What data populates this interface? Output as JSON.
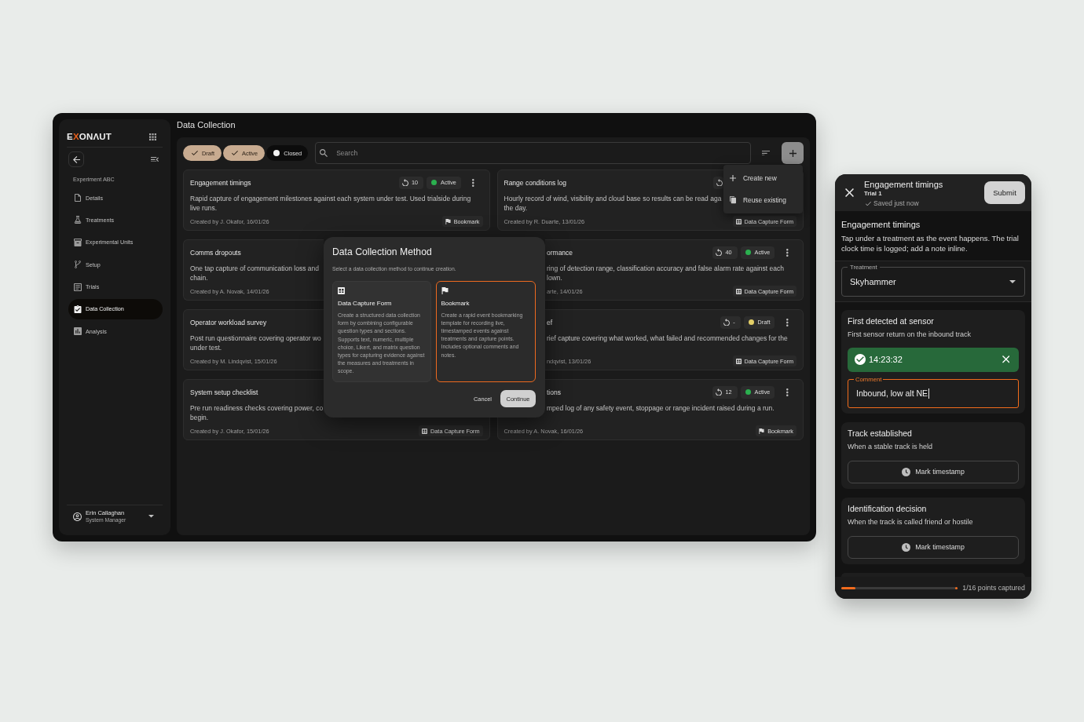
{
  "page": {
    "title": "Data Collection"
  },
  "sidebar": {
    "logo": [
      {
        "text": "E",
        "accent": false
      },
      {
        "text": "X",
        "accent": true
      },
      {
        "text": "ONΛUT",
        "accent": false
      }
    ],
    "section": "Experiment ABC",
    "items": [
      {
        "label": "Details",
        "selected": false
      },
      {
        "label": "Treatments",
        "selected": false
      },
      {
        "label": "Experimental Units",
        "selected": false
      },
      {
        "label": "Setup",
        "selected": false
      },
      {
        "label": "Trials",
        "selected": false
      },
      {
        "label": "Data Collection",
        "selected": true
      },
      {
        "label": "Analysis",
        "selected": false
      }
    ],
    "user": {
      "name": "Erin Callaghan",
      "role": "System Manager"
    }
  },
  "toolbar": {
    "filters": [
      {
        "label": "Draft",
        "selected": true
      },
      {
        "label": "Active",
        "selected": true
      },
      {
        "label": "Closed",
        "selected": false
      }
    ],
    "search": {
      "placeholder": "Search"
    },
    "create_menu": {
      "open": true,
      "items": [
        "Create new",
        "Reuse existing"
      ]
    }
  },
  "cards": [
    {
      "title": "Engagement timings",
      "badges": [
        {
          "kind": "counter",
          "value": "10"
        },
        {
          "kind": "status",
          "label": "Active",
          "color": "#2bb04f"
        }
      ],
      "menu": true,
      "description": [
        "Rapid capture of engagement milestones against each system under test. Used trialside during",
        "live runs."
      ],
      "created": "Created by J. Okafor, 16/01/26",
      "type": {
        "kind": "bookmark",
        "label": "Bookmark"
      }
    },
    {
      "title": "Range conditions log",
      "badges": [
        {
          "kind": "counter"
        }
      ],
      "menu": false,
      "description": [
        "Hourly record of wind, visibility and cloud base so results can be read aga",
        "the day."
      ],
      "created": "Created by R. Duarte, 13/01/26",
      "type": {
        "kind": "form",
        "label": "Data Capture Form"
      }
    },
    {
      "title": "Comms dropouts",
      "menu": false,
      "description": [
        "One tap capture of communication loss and",
        "chain."
      ],
      "created": "Created by A. Novak, 14/01/26"
    },
    {
      "title": "ormance",
      "badges": [
        {
          "kind": "counter",
          "value": "40"
        },
        {
          "kind": "status",
          "label": "Active",
          "color": "#2bb04f"
        }
      ],
      "menu": true,
      "description": [
        "ring of detection range, classification accuracy and false alarm rate against each",
        "lown."
      ],
      "created": "arte, 14/01/26",
      "type": {
        "kind": "form",
        "label": "Data Capture Form"
      }
    },
    {
      "title": "Operator workload survey",
      "menu": false,
      "description": [
        "Post run questionnaire covering operator wo",
        "under test."
      ],
      "created": "Created by M. Lindqvist, 15/01/26"
    },
    {
      "title": "ef",
      "badges": [
        {
          "kind": "counter",
          "value": "-"
        },
        {
          "kind": "status",
          "label": "Draft",
          "color": "#e3cf67"
        }
      ],
      "menu": true,
      "description": [
        "rief capture covering what worked, what failed and recommended changes for the"
      ],
      "created": "ndqvist, 13/01/26",
      "type": {
        "kind": "form",
        "label": "Data Capture Form"
      }
    },
    {
      "title": "System setup checklist",
      "menu": false,
      "description": [
        "Pre run readiness checks covering power, co",
        "begin."
      ],
      "created": "Created by J. Okafor, 15/01/26",
      "type": {
        "kind": "form",
        "label": "Data Capture Form"
      }
    },
    {
      "title": "tions",
      "badges": [
        {
          "kind": "counter",
          "value": "12"
        },
        {
          "kind": "status",
          "label": "Active",
          "color": "#2bb04f"
        }
      ],
      "menu": true,
      "description": [
        "mped log of any safety event, stoppage or range incident raised during a run."
      ],
      "created": "Created by A. Novak, 16/01/26",
      "type": {
        "kind": "bookmark",
        "label": "Bookmark"
      }
    }
  ],
  "dialog": {
    "title": "Data Collection Method",
    "subtitle": "Select a data collection method to continue creation.",
    "options": [
      {
        "kind": "form",
        "title": "Data Capture Form",
        "description": "Create a structured data collection form by combining configurable question types and sections. Supports text, numeric, multiple choice, Likert, and matrix question types for capturing evidence against the measures and treatments in scope.",
        "selected": false
      },
      {
        "kind": "bookmark",
        "title": "Bookmark",
        "description": "Create a rapid event bookmarking template for recording live, timestamped events against treatments and capture points. Includes optional comments and notes.",
        "selected": true
      }
    ],
    "buttons": [
      {
        "kind": "text",
        "label": "Cancel"
      },
      {
        "kind": "filled",
        "label": "Continue"
      }
    ]
  },
  "mobile": {
    "header": {
      "title": "Engagement timings",
      "subtitle": "Trial 1",
      "status": "Saved just now",
      "action": "Submit"
    },
    "intro": {
      "title": "Engagement timings",
      "text": "Tap under a treatment as the event happens. The trial clock time is logged; add a note inline."
    },
    "treatment": {
      "label": "Treatment",
      "value": "Skyhammer"
    },
    "events": [
      {
        "kind": "captured",
        "title": "First detected at sensor",
        "hint": "First sensor return on the inbound track",
        "time": "14:23:32",
        "comment": {
          "label": "Comment",
          "value": "Inbound, low alt NE",
          "focused": true
        }
      },
      {
        "kind": "pending",
        "title": "Track established",
        "hint": "When a stable track is held",
        "action": "Mark timestamp"
      },
      {
        "kind": "pending",
        "title": "Identification decision",
        "hint": "When the track is called friend or hostile",
        "action": "Mark timestamp"
      }
    ],
    "progress": {
      "level": 0.12,
      "label": "1/16 points captured"
    }
  }
}
